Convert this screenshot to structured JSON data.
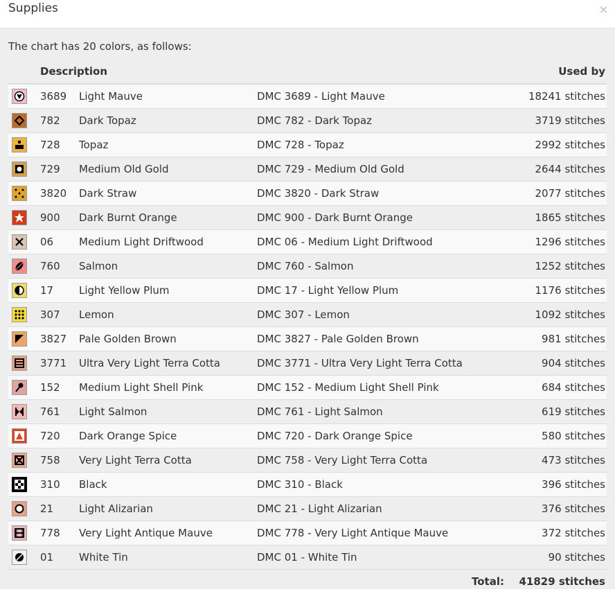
{
  "dialog": {
    "title": "Supplies",
    "close_label": "×"
  },
  "intro": "The chart has 20 colors, as follows:",
  "table": {
    "header_description": "Description",
    "header_used_by": "Used by",
    "rows": [
      {
        "code": "3689",
        "name": "Light Mauve",
        "desc": "DMC 3689 - Light Mauve",
        "used": "18241 stitches",
        "color": "#f0bccc",
        "symbol": "heart-icon"
      },
      {
        "code": "782",
        "name": "Dark Topaz",
        "desc": "DMC 782 - Dark Topaz",
        "used": "3719 stitches",
        "color": "#b86c30",
        "symbol": "diamond-icon"
      },
      {
        "code": "728",
        "name": "Topaz",
        "desc": "DMC 728 - Topaz",
        "used": "2992 stitches",
        "color": "#f0b43c",
        "symbol": "podium-icon"
      },
      {
        "code": "729",
        "name": "Medium Old Gold",
        "desc": "DMC 729 - Medium Old Gold",
        "used": "2644 stitches",
        "color": "#d4a050",
        "symbol": "square-dot-icon"
      },
      {
        "code": "3820",
        "name": "Dark Straw",
        "desc": "DMC 3820 - Dark Straw",
        "used": "2077 stitches",
        "color": "#dca430",
        "symbol": "dice-five-icon"
      },
      {
        "code": "900",
        "name": "Dark Burnt Orange",
        "desc": "DMC 900 - Dark Burnt Orange",
        "used": "1865 stitches",
        "color": "#d03c1c",
        "symbol": "star-icon"
      },
      {
        "code": "06",
        "name": "Medium Light Driftwood",
        "desc": "DMC 06 - Medium Light Driftwood",
        "used": "1296 stitches",
        "color": "#d8c4b4",
        "symbol": "x-cross-icon"
      },
      {
        "code": "760",
        "name": "Salmon",
        "desc": "DMC 760 - Salmon",
        "used": "1252 stitches",
        "color": "#f08c8c",
        "symbol": "leaf-icon"
      },
      {
        "code": "17",
        "name": "Light Yellow Plum",
        "desc": "DMC 17 - Light Yellow Plum",
        "used": "1176 stitches",
        "color": "#ecdc6c",
        "symbol": "half-circle-icon"
      },
      {
        "code": "307",
        "name": "Lemon",
        "desc": "DMC 307 - Lemon",
        "used": "1092 stitches",
        "color": "#f8dc40",
        "symbol": "dot-grid-icon"
      },
      {
        "code": "3827",
        "name": "Pale Golden Brown",
        "desc": "DMC 3827 - Pale Golden Brown",
        "used": "981 stitches",
        "color": "#eca468",
        "symbol": "half-triangle-icon"
      },
      {
        "code": "3771",
        "name": "Ultra Very Light Terra Cotta",
        "desc": "DMC 3771 - Ultra Very Light Terra Cotta",
        "used": "904 stitches",
        "color": "#e4a48c",
        "symbol": "lines-box-icon"
      },
      {
        "code": "152",
        "name": "Medium Light Shell Pink",
        "desc": "DMC 152 - Medium Light Shell Pink",
        "used": "684 stitches",
        "color": "#e0a4a0",
        "symbol": "pin-icon"
      },
      {
        "code": "761",
        "name": "Light Salmon",
        "desc": "DMC 761 - Light Salmon",
        "used": "619 stitches",
        "color": "#f4b8b4",
        "symbol": "bowtie-icon"
      },
      {
        "code": "720",
        "name": "Dark Orange Spice",
        "desc": "DMC 720 - Dark Orange Spice",
        "used": "580 stitches",
        "color": "#d84828",
        "symbol": "triangle-icon"
      },
      {
        "code": "758",
        "name": "Very Light Terra Cotta",
        "desc": "DMC 758 - Very Light Terra Cotta",
        "used": "473 stitches",
        "color": "#e8a890",
        "symbol": "cross-box-icon"
      },
      {
        "code": "310",
        "name": "Black",
        "desc": "DMC 310 - Black",
        "used": "396 stitches",
        "color": "#000000",
        "symbol": "plus-grid-icon"
      },
      {
        "code": "21",
        "name": "Light Alizarian",
        "desc": "DMC 21 - Light Alizarian",
        "used": "376 stitches",
        "color": "#e8a088",
        "symbol": "circle-icon"
      },
      {
        "code": "778",
        "name": "Very Light Antique Mauve",
        "desc": "DMC 778 - Very Light Antique Mauve",
        "used": "372 stitches",
        "color": "#e4b8bc",
        "symbol": "h-box-icon"
      },
      {
        "code": "01",
        "name": "White Tin",
        "desc": "DMC 01 - White Tin",
        "used": "90 stitches",
        "color": "#f0f0f0",
        "symbol": "slashed-circle-icon"
      }
    ],
    "total_label": "Total:",
    "total_value": "41829 stitches"
  }
}
